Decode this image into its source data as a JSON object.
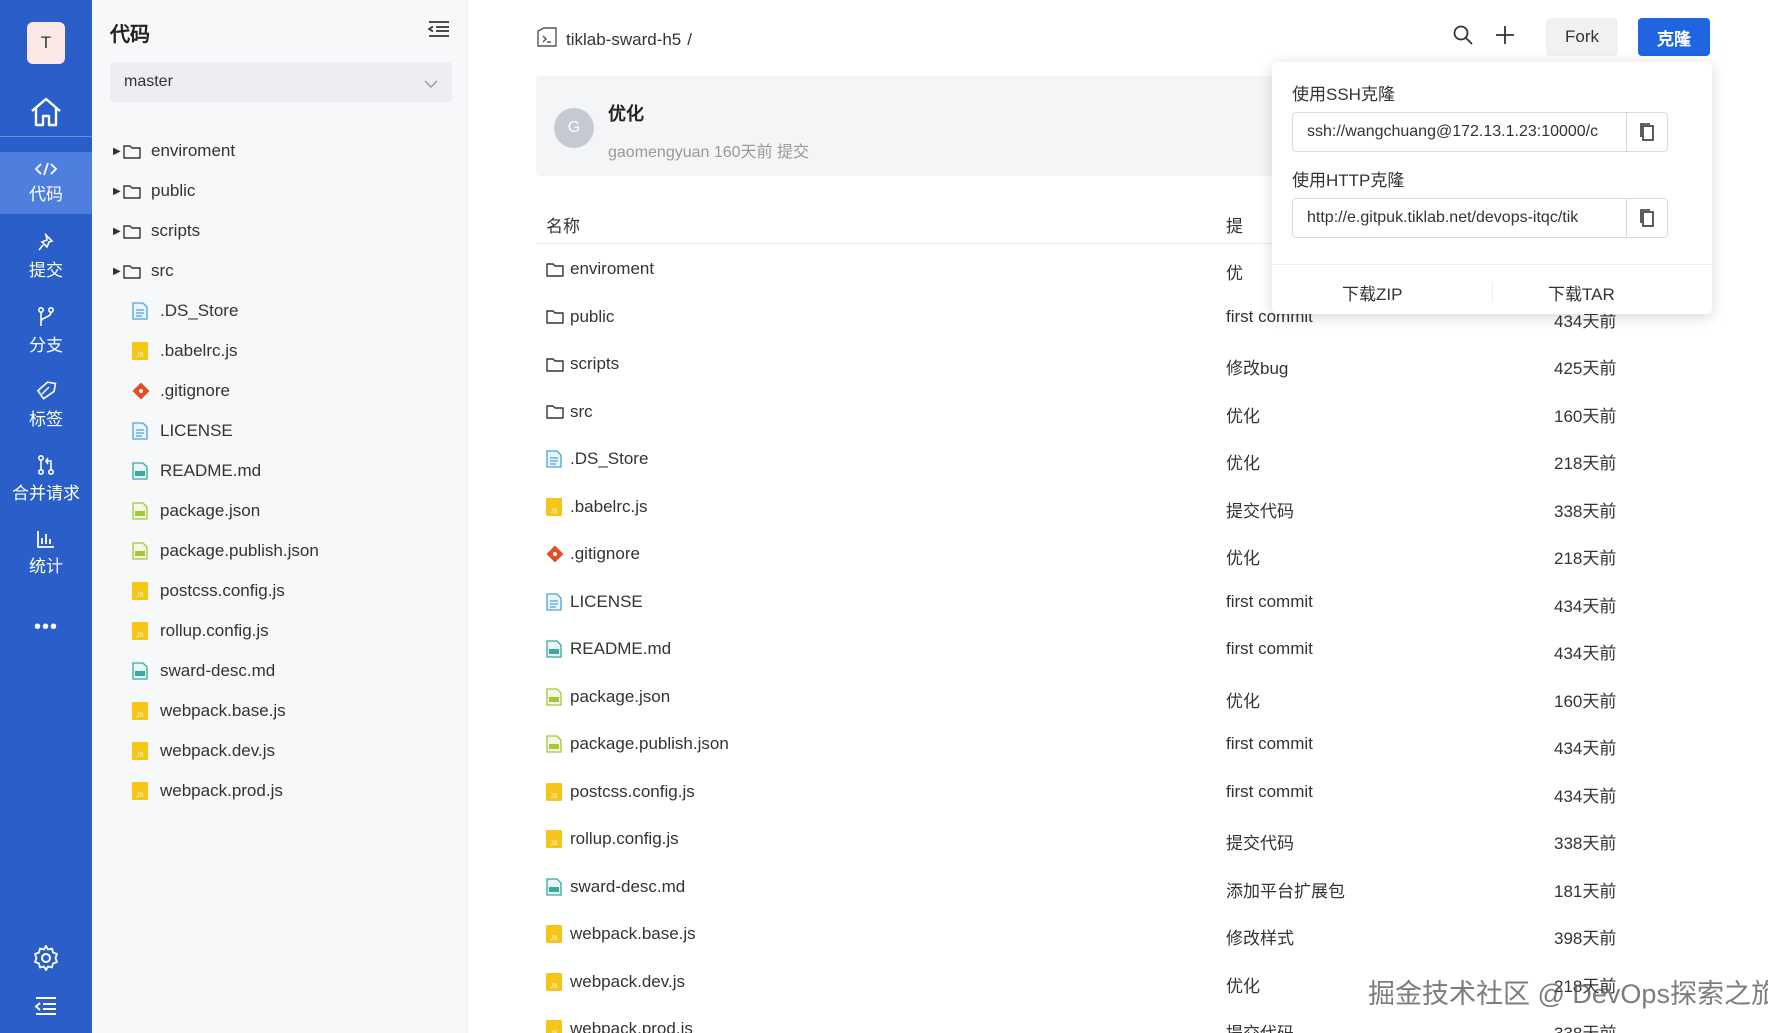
{
  "rail": {
    "avatar_letter": "T",
    "items": [
      {
        "label": "代码",
        "icon": "code-icon"
      },
      {
        "label": "提交",
        "icon": "commit-pin-icon"
      },
      {
        "label": "分支",
        "icon": "branch-icon"
      },
      {
        "label": "标签",
        "icon": "tag-icon"
      },
      {
        "label": "合并请求",
        "icon": "merge-request-icon"
      },
      {
        "label": "统计",
        "icon": "stats-icon"
      }
    ],
    "more": "•••",
    "accent": "#2a5fc9",
    "active_bg": "#4f7fde"
  },
  "tree": {
    "title": "代码",
    "branch": "master",
    "items": [
      {
        "name": "enviroment",
        "type": "dir"
      },
      {
        "name": "public",
        "type": "dir"
      },
      {
        "name": "scripts",
        "type": "dir"
      },
      {
        "name": "src",
        "type": "dir"
      },
      {
        "name": ".DS_Store",
        "type": "doc"
      },
      {
        "name": ".babelrc.js",
        "type": "js"
      },
      {
        "name": ".gitignore",
        "type": "git"
      },
      {
        "name": "LICENSE",
        "type": "doc"
      },
      {
        "name": "README.md",
        "type": "md"
      },
      {
        "name": "package.json",
        "type": "json"
      },
      {
        "name": "package.publish.json",
        "type": "json"
      },
      {
        "name": "postcss.config.js",
        "type": "js"
      },
      {
        "name": "rollup.config.js",
        "type": "js"
      },
      {
        "name": "sward-desc.md",
        "type": "md"
      },
      {
        "name": "webpack.base.js",
        "type": "js"
      },
      {
        "name": "webpack.dev.js",
        "type": "js"
      },
      {
        "name": "webpack.prod.js",
        "type": "js"
      }
    ]
  },
  "header": {
    "repo": "tiklab-sward-h5",
    "sep": "/",
    "fork": "Fork",
    "clone": "克隆"
  },
  "commit": {
    "avatar": "G",
    "message": "优化",
    "meta": "gaomengyuan 160天前 提交"
  },
  "table": {
    "headers": {
      "name": "名称",
      "commit": "提",
      "time": ""
    },
    "rows": [
      {
        "name": "enviroment",
        "type": "dir",
        "commit": "优",
        "time": ""
      },
      {
        "name": "public",
        "type": "dir",
        "commit": "first commit",
        "time": "434天前"
      },
      {
        "name": "scripts",
        "type": "dir",
        "commit": "修改bug",
        "time": "425天前"
      },
      {
        "name": "src",
        "type": "dir",
        "commit": "优化",
        "time": "160天前"
      },
      {
        "name": ".DS_Store",
        "type": "doc",
        "commit": "优化",
        "time": "218天前"
      },
      {
        "name": ".babelrc.js",
        "type": "js",
        "commit": "提交代码",
        "time": "338天前"
      },
      {
        "name": ".gitignore",
        "type": "git",
        "commit": "优化",
        "time": "218天前"
      },
      {
        "name": "LICENSE",
        "type": "doc",
        "commit": "first commit",
        "time": "434天前"
      },
      {
        "name": "README.md",
        "type": "md",
        "commit": "first commit",
        "time": "434天前"
      },
      {
        "name": "package.json",
        "type": "json",
        "commit": "优化",
        "time": "160天前"
      },
      {
        "name": "package.publish.json",
        "type": "json",
        "commit": "first commit",
        "time": "434天前"
      },
      {
        "name": "postcss.config.js",
        "type": "js",
        "commit": "first commit",
        "time": "434天前"
      },
      {
        "name": "rollup.config.js",
        "type": "js",
        "commit": "提交代码",
        "time": "338天前"
      },
      {
        "name": "sward-desc.md",
        "type": "md",
        "commit": "添加平台扩展包",
        "time": "181天前"
      },
      {
        "name": "webpack.base.js",
        "type": "js",
        "commit": "修改样式",
        "time": "398天前"
      },
      {
        "name": "webpack.dev.js",
        "type": "js",
        "commit": "优化",
        "time": "218天前"
      },
      {
        "name": "webpack.prod.js",
        "type": "js",
        "commit": "提交代码",
        "time": "338天前"
      }
    ]
  },
  "clone_dropdown": {
    "ssh_label": "使用SSH克隆",
    "ssh_url": "ssh://wangchuang@172.13.1.23:10000/c",
    "http_label": "使用HTTP克隆",
    "http_url": "http://e.gitpuk.tiklab.net/devops-itqc/tik",
    "download_zip": "下载ZIP",
    "download_tar": "下载TAR"
  },
  "watermark": "掘金技术社区 @ DevOps探索之旅",
  "colors": {
    "primary": "#1f64e0",
    "js_icon": "#f5c518",
    "git_icon": "#e44d26",
    "md_icon": "#3aa8a0",
    "json_icon": "#a4c639",
    "doc_icon": "#4aa3df"
  }
}
